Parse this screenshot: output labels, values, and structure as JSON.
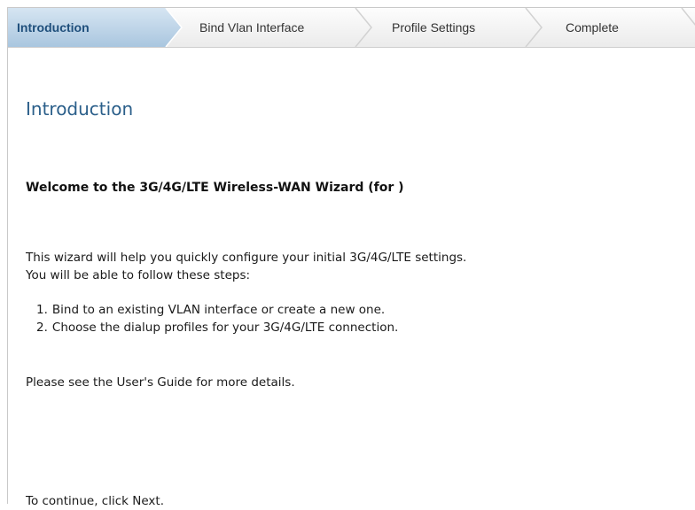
{
  "wizard": {
    "steps": [
      {
        "label": "Introduction",
        "active": true
      },
      {
        "label": "Bind Vlan Interface",
        "active": false
      },
      {
        "label": "Profile Settings",
        "active": false
      },
      {
        "label": "Complete",
        "active": false
      }
    ],
    "colors": {
      "active_step_fill": "#bcd4e8",
      "active_step_text": "#1f4f7c",
      "title": "#2b5f8a"
    }
  },
  "page": {
    "title": "Introduction",
    "welcome_heading": "Welcome to the 3G/4G/LTE Wireless-WAN Wizard (for )",
    "intro_lines": [
      "This wizard will help you quickly configure your initial 3G/4G/LTE settings.",
      "You will be able to follow these steps:"
    ],
    "steps_list": [
      {
        "number": "1.",
        "text": "Bind to an existing VLAN interface or create a new one."
      },
      {
        "number": "2.",
        "text": "Choose the dialup profiles for your 3G/4G/LTE connection."
      }
    ],
    "guide_note": "Please see the User's Guide for more details.",
    "continue_note": "To continue, click Next."
  }
}
